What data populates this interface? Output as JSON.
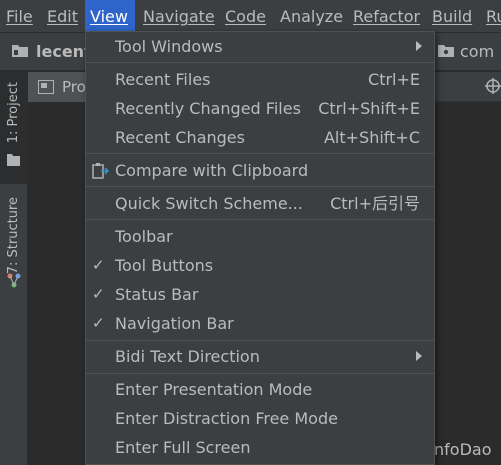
{
  "menubar": {
    "items": [
      {
        "label": "File",
        "mnemonic": "F"
      },
      {
        "label": "Edit",
        "mnemonic": "E"
      },
      {
        "label": "View",
        "mnemonic": "V"
      },
      {
        "label": "Navigate",
        "mnemonic": "N"
      },
      {
        "label": "Code",
        "mnemonic": "C"
      },
      {
        "label": "Analyze",
        "mnemonic": ""
      },
      {
        "label": "Refactor",
        "mnemonic": "R"
      },
      {
        "label": "Build",
        "mnemonic": "B"
      },
      {
        "label": "Ru",
        "mnemonic": "R"
      }
    ]
  },
  "navbar": {
    "project_name": "lecent",
    "package_name": "com"
  },
  "sidebar": {
    "project_tab": "1: Project",
    "structure_tab": "7: Structure"
  },
  "project_panel": {
    "tab_label": "Pro"
  },
  "background_text": "nfoDao",
  "view_menu": {
    "tool_windows": "Tool Windows",
    "recent_files": "Recent Files",
    "recent_files_shortcut": "Ctrl+E",
    "recently_changed_files": "Recently Changed Files",
    "recently_changed_files_shortcut": "Ctrl+Shift+E",
    "recent_changes": "Recent Changes",
    "recent_changes_shortcut": "Alt+Shift+C",
    "compare_with_clipboard": "Compare with Clipboard",
    "quick_switch_scheme": "Quick Switch Scheme...",
    "quick_switch_scheme_shortcut": "Ctrl+后引号",
    "toolbar": "Toolbar",
    "tool_buttons": "Tool Buttons",
    "status_bar": "Status Bar",
    "navigation_bar": "Navigation Bar",
    "bidi_text_direction": "Bidi Text Direction",
    "enter_presentation_mode": "Enter Presentation Mode",
    "enter_distraction_free_mode": "Enter Distraction Free Mode",
    "enter_full_screen": "Enter Full Screen",
    "check_mark": "✓",
    "checked": {
      "toolbar": false,
      "tool_buttons": true,
      "status_bar": true,
      "navigation_bar": true
    }
  },
  "colors": {
    "accent": "#2F65CA",
    "background": "#2B2B2B",
    "panel": "#3C3F41",
    "text": "#BBBBBB"
  }
}
